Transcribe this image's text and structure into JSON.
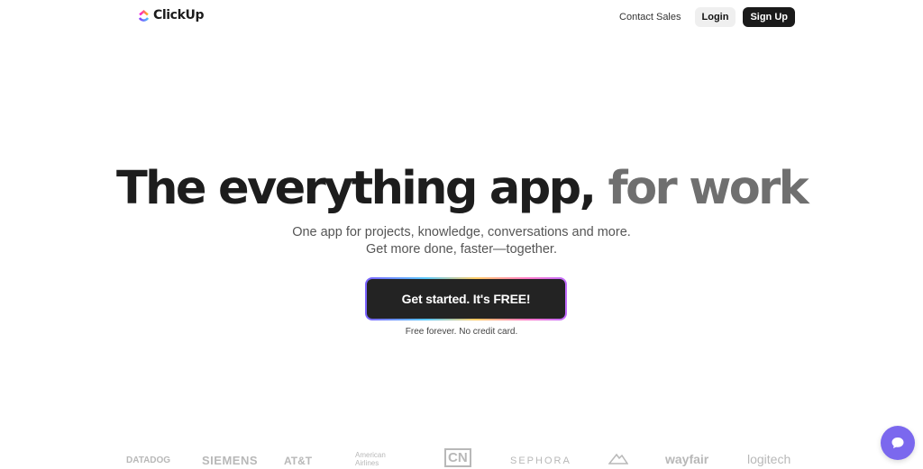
{
  "header": {
    "logo_text": "ClickUp",
    "contact_label": "Contact Sales",
    "login_label": "Login",
    "signup_label": "Sign Up"
  },
  "hero": {
    "title_main": "The everything app,",
    "title_accent": "for work",
    "subtitle_line1": "One app for projects, knowledge, conversations and more.",
    "subtitle_line2": "Get more done, faster—together.",
    "cta_label": "Get started. It's FREE!",
    "cta_note": "Free forever. No credit card."
  },
  "brands": {
    "datadog": "DATADOG",
    "siemens": "SIEMENS",
    "att": "AT&T",
    "american_airlines_1": "American",
    "american_airlines_2": "Airlines",
    "cn": "CN",
    "sephora": "SEPHORA",
    "wayfair": "wayfair",
    "logitech": "logitech"
  },
  "colors": {
    "brand_purple": "#7b68ee",
    "cta_bg": "#232323",
    "text_dark": "#1d1d1d",
    "text_accent_gray": "#6f6f6f"
  },
  "icons": {
    "logo": "clickup-logo-icon",
    "chat": "chat-bubble-icon"
  }
}
